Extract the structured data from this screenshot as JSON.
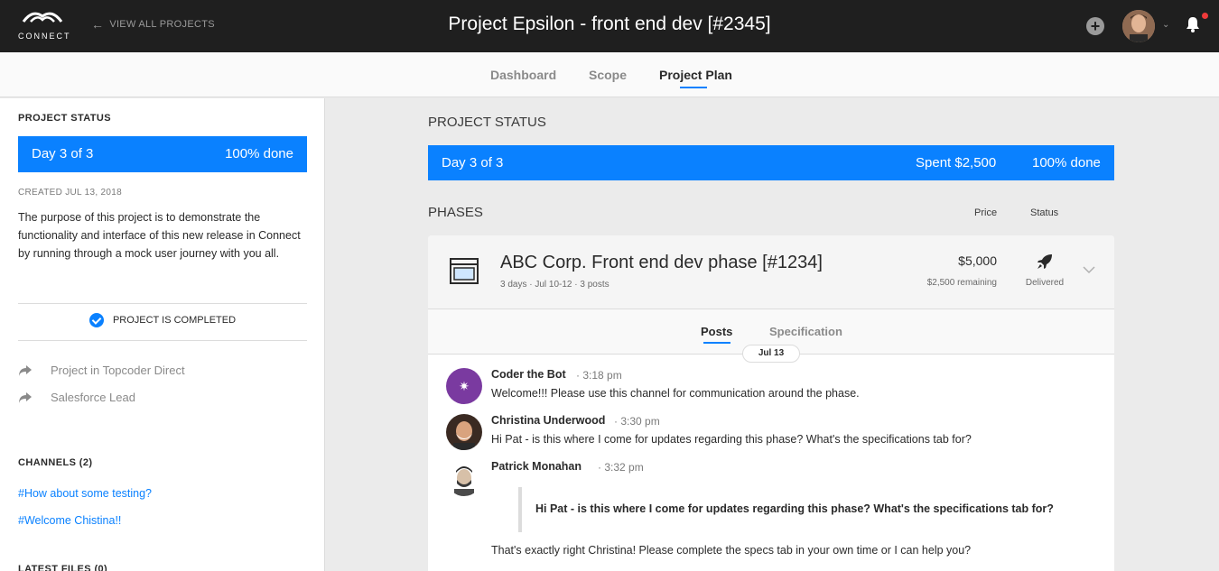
{
  "header": {
    "logo_text": "CONNECT",
    "back_label": "VIEW ALL PROJECTS",
    "title": "Project Epsilon - front end dev [#2345]",
    "notification_color": "#ef3a3a"
  },
  "nav": {
    "tabs": [
      {
        "label": "Dashboard",
        "active": false
      },
      {
        "label": "Scope",
        "active": false
      },
      {
        "label": "Project Plan",
        "active": true
      }
    ]
  },
  "sidebar": {
    "status_heading": "PROJECT STATUS",
    "status_day": "Day 3 of 3",
    "status_done": "100% done",
    "created": "CREATED JUL 13, 2018",
    "description": "The purpose of this project is to demonstrate the functionality and interface of this new release in Connect by running through a mock user journey with you all.",
    "completed_label": "PROJECT IS COMPLETED",
    "links": [
      {
        "label": "Project in Topcoder Direct",
        "icon": "share-arrow-icon"
      },
      {
        "label": "Salesforce Lead",
        "icon": "share-arrow-icon"
      }
    ],
    "channels_heading": "CHANNELS (2)",
    "channels": [
      "#How about some testing?",
      "#Welcome Chistina!!"
    ],
    "files_heading": "LATEST FILES (0)"
  },
  "main": {
    "status_heading": "PROJECT STATUS",
    "status_day": "Day 3 of 3",
    "status_spent": "Spent $2,500",
    "status_done": "100% done",
    "phases_heading": "PHASES",
    "col_price": "Price",
    "col_status": "Status",
    "accent_color": "#0a81ff",
    "phase": {
      "title": "ABC Corp. Front end dev phase [#1234]",
      "meta": "3 days · Jul 10-12 · 3 posts",
      "price": "$5,000",
      "remaining": "$2,500 remaining",
      "status": "Delivered",
      "tabs": [
        {
          "label": "Posts",
          "active": true
        },
        {
          "label": "Specification",
          "active": false
        }
      ],
      "date_pill": "Jul 13",
      "posts": [
        {
          "author": "Coder the Bot",
          "time": "· 3:18 pm",
          "body": "Welcome!!! Please use this channel for communication around the phase."
        },
        {
          "author": "Christina Underwood",
          "time": "· 3:30 pm",
          "body": "Hi Pat - is this where I come for updates regarding this phase? What's the specifications tab for?"
        },
        {
          "author": "Patrick Monahan",
          "time": "· 3:32 pm",
          "quote": "Hi Pat - is this where I come for updates regarding this phase? What's the specifications tab for?",
          "body": "That's exactly right Christina! Please complete the specs tab in your own time or I can help you?"
        }
      ]
    }
  }
}
